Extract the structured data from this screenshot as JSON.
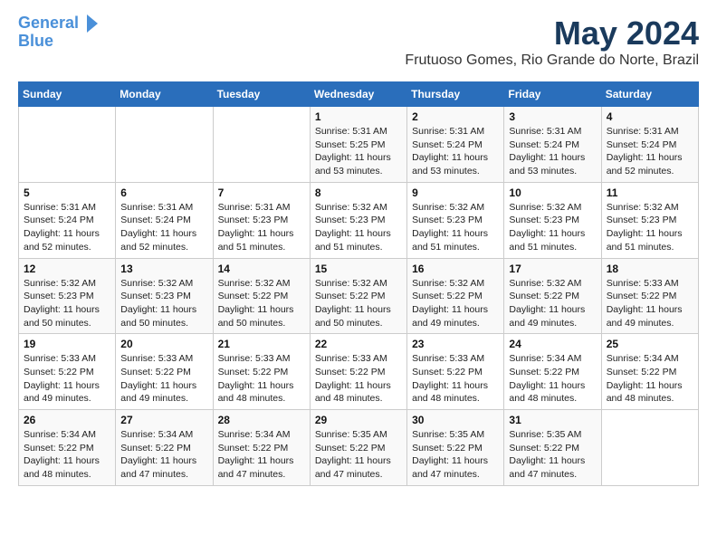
{
  "logo": {
    "line1": "General",
    "line2": "Blue"
  },
  "header": {
    "month": "May 2024",
    "location": "Frutuoso Gomes, Rio Grande do Norte, Brazil"
  },
  "weekdays": [
    "Sunday",
    "Monday",
    "Tuesday",
    "Wednesday",
    "Thursday",
    "Friday",
    "Saturday"
  ],
  "weeks": [
    [
      {
        "day": "",
        "sunrise": "",
        "sunset": "",
        "daylight": ""
      },
      {
        "day": "",
        "sunrise": "",
        "sunset": "",
        "daylight": ""
      },
      {
        "day": "",
        "sunrise": "",
        "sunset": "",
        "daylight": ""
      },
      {
        "day": "1",
        "sunrise": "Sunrise: 5:31 AM",
        "sunset": "Sunset: 5:25 PM",
        "daylight": "Daylight: 11 hours and 53 minutes."
      },
      {
        "day": "2",
        "sunrise": "Sunrise: 5:31 AM",
        "sunset": "Sunset: 5:24 PM",
        "daylight": "Daylight: 11 hours and 53 minutes."
      },
      {
        "day": "3",
        "sunrise": "Sunrise: 5:31 AM",
        "sunset": "Sunset: 5:24 PM",
        "daylight": "Daylight: 11 hours and 53 minutes."
      },
      {
        "day": "4",
        "sunrise": "Sunrise: 5:31 AM",
        "sunset": "Sunset: 5:24 PM",
        "daylight": "Daylight: 11 hours and 52 minutes."
      }
    ],
    [
      {
        "day": "5",
        "sunrise": "Sunrise: 5:31 AM",
        "sunset": "Sunset: 5:24 PM",
        "daylight": "Daylight: 11 hours and 52 minutes."
      },
      {
        "day": "6",
        "sunrise": "Sunrise: 5:31 AM",
        "sunset": "Sunset: 5:24 PM",
        "daylight": "Daylight: 11 hours and 52 minutes."
      },
      {
        "day": "7",
        "sunrise": "Sunrise: 5:31 AM",
        "sunset": "Sunset: 5:23 PM",
        "daylight": "Daylight: 11 hours and 51 minutes."
      },
      {
        "day": "8",
        "sunrise": "Sunrise: 5:32 AM",
        "sunset": "Sunset: 5:23 PM",
        "daylight": "Daylight: 11 hours and 51 minutes."
      },
      {
        "day": "9",
        "sunrise": "Sunrise: 5:32 AM",
        "sunset": "Sunset: 5:23 PM",
        "daylight": "Daylight: 11 hours and 51 minutes."
      },
      {
        "day": "10",
        "sunrise": "Sunrise: 5:32 AM",
        "sunset": "Sunset: 5:23 PM",
        "daylight": "Daylight: 11 hours and 51 minutes."
      },
      {
        "day": "11",
        "sunrise": "Sunrise: 5:32 AM",
        "sunset": "Sunset: 5:23 PM",
        "daylight": "Daylight: 11 hours and 51 minutes."
      }
    ],
    [
      {
        "day": "12",
        "sunrise": "Sunrise: 5:32 AM",
        "sunset": "Sunset: 5:23 PM",
        "daylight": "Daylight: 11 hours and 50 minutes."
      },
      {
        "day": "13",
        "sunrise": "Sunrise: 5:32 AM",
        "sunset": "Sunset: 5:23 PM",
        "daylight": "Daylight: 11 hours and 50 minutes."
      },
      {
        "day": "14",
        "sunrise": "Sunrise: 5:32 AM",
        "sunset": "Sunset: 5:22 PM",
        "daylight": "Daylight: 11 hours and 50 minutes."
      },
      {
        "day": "15",
        "sunrise": "Sunrise: 5:32 AM",
        "sunset": "Sunset: 5:22 PM",
        "daylight": "Daylight: 11 hours and 50 minutes."
      },
      {
        "day": "16",
        "sunrise": "Sunrise: 5:32 AM",
        "sunset": "Sunset: 5:22 PM",
        "daylight": "Daylight: 11 hours and 49 minutes."
      },
      {
        "day": "17",
        "sunrise": "Sunrise: 5:32 AM",
        "sunset": "Sunset: 5:22 PM",
        "daylight": "Daylight: 11 hours and 49 minutes."
      },
      {
        "day": "18",
        "sunrise": "Sunrise: 5:33 AM",
        "sunset": "Sunset: 5:22 PM",
        "daylight": "Daylight: 11 hours and 49 minutes."
      }
    ],
    [
      {
        "day": "19",
        "sunrise": "Sunrise: 5:33 AM",
        "sunset": "Sunset: 5:22 PM",
        "daylight": "Daylight: 11 hours and 49 minutes."
      },
      {
        "day": "20",
        "sunrise": "Sunrise: 5:33 AM",
        "sunset": "Sunset: 5:22 PM",
        "daylight": "Daylight: 11 hours and 49 minutes."
      },
      {
        "day": "21",
        "sunrise": "Sunrise: 5:33 AM",
        "sunset": "Sunset: 5:22 PM",
        "daylight": "Daylight: 11 hours and 48 minutes."
      },
      {
        "day": "22",
        "sunrise": "Sunrise: 5:33 AM",
        "sunset": "Sunset: 5:22 PM",
        "daylight": "Daylight: 11 hours and 48 minutes."
      },
      {
        "day": "23",
        "sunrise": "Sunrise: 5:33 AM",
        "sunset": "Sunset: 5:22 PM",
        "daylight": "Daylight: 11 hours and 48 minutes."
      },
      {
        "day": "24",
        "sunrise": "Sunrise: 5:34 AM",
        "sunset": "Sunset: 5:22 PM",
        "daylight": "Daylight: 11 hours and 48 minutes."
      },
      {
        "day": "25",
        "sunrise": "Sunrise: 5:34 AM",
        "sunset": "Sunset: 5:22 PM",
        "daylight": "Daylight: 11 hours and 48 minutes."
      }
    ],
    [
      {
        "day": "26",
        "sunrise": "Sunrise: 5:34 AM",
        "sunset": "Sunset: 5:22 PM",
        "daylight": "Daylight: 11 hours and 48 minutes."
      },
      {
        "day": "27",
        "sunrise": "Sunrise: 5:34 AM",
        "sunset": "Sunset: 5:22 PM",
        "daylight": "Daylight: 11 hours and 47 minutes."
      },
      {
        "day": "28",
        "sunrise": "Sunrise: 5:34 AM",
        "sunset": "Sunset: 5:22 PM",
        "daylight": "Daylight: 11 hours and 47 minutes."
      },
      {
        "day": "29",
        "sunrise": "Sunrise: 5:35 AM",
        "sunset": "Sunset: 5:22 PM",
        "daylight": "Daylight: 11 hours and 47 minutes."
      },
      {
        "day": "30",
        "sunrise": "Sunrise: 5:35 AM",
        "sunset": "Sunset: 5:22 PM",
        "daylight": "Daylight: 11 hours and 47 minutes."
      },
      {
        "day": "31",
        "sunrise": "Sunrise: 5:35 AM",
        "sunset": "Sunset: 5:22 PM",
        "daylight": "Daylight: 11 hours and 47 minutes."
      },
      {
        "day": "",
        "sunrise": "",
        "sunset": "",
        "daylight": ""
      }
    ]
  ]
}
